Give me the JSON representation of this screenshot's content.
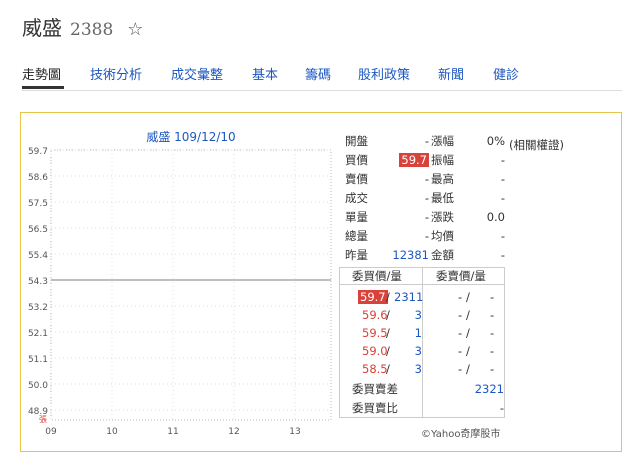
{
  "header": {
    "stock_name": "威盛",
    "stock_code": "2388",
    "favorite_icon": "star-outline-icon"
  },
  "tabs": [
    {
      "label": "走勢圖",
      "active": true
    },
    {
      "label": "技術分析"
    },
    {
      "label": "成交彙整"
    },
    {
      "label": "基本"
    },
    {
      "label": "籌碼"
    },
    {
      "label": "股利政策"
    },
    {
      "label": "新聞"
    },
    {
      "label": "健診"
    }
  ],
  "chart_data": {
    "type": "line",
    "title": "威盛 109/12/10",
    "y_ticks": [
      "59.7",
      "58.6",
      "57.5",
      "56.5",
      "55.4",
      "54.3",
      "53.2",
      "52.1",
      "51.1",
      "50.0",
      "48.9"
    ],
    "y_range": [
      48.9,
      59.7
    ],
    "x_ticks": [
      "09",
      "10",
      "11",
      "12",
      "13"
    ],
    "reference_price": 54.3,
    "bottom_left_label": "張",
    "grid": "dotted"
  },
  "quote": {
    "left": [
      {
        "label": "開盤",
        "value": "-"
      },
      {
        "label": "買價",
        "value": "59.7",
        "highlight": true
      },
      {
        "label": "賣價",
        "value": "-"
      },
      {
        "label": "成交",
        "value": "-"
      },
      {
        "label": "單量",
        "value": "-"
      },
      {
        "label": "總量",
        "value": "-"
      },
      {
        "label": "昨量",
        "value": "12381"
      }
    ],
    "right": [
      {
        "label": "漲幅",
        "value": "0%"
      },
      {
        "label": "振幅",
        "value": "-"
      },
      {
        "label": "最高",
        "value": "-"
      },
      {
        "label": "最低",
        "value": "-"
      },
      {
        "label": "漲跌",
        "value": "0.0"
      },
      {
        "label": "均價",
        "value": "-"
      },
      {
        "label": "金額",
        "value": "-"
      }
    ],
    "related_link": "(相關權證)"
  },
  "order_book": {
    "bid_header": "委買價/量",
    "ask_header": "委賣價/量",
    "bids": [
      {
        "price": "59.7",
        "vol": "2311"
      },
      {
        "price": "59.6",
        "vol": "3"
      },
      {
        "price": "59.5",
        "vol": "1"
      },
      {
        "price": "59.0",
        "vol": "3"
      },
      {
        "price": "58.5",
        "vol": "3"
      }
    ],
    "asks": [
      {
        "price": "-",
        "vol": "-"
      },
      {
        "price": "-",
        "vol": "-"
      },
      {
        "price": "-",
        "vol": "-"
      },
      {
        "price": "-",
        "vol": "-"
      },
      {
        "price": "-",
        "vol": "-"
      }
    ],
    "bid_ask_diff_label": "委買賣差",
    "bid_ask_diff_value": "2321",
    "bid_ask_ratio_label": "委買賣比",
    "bid_ask_ratio_value": "-"
  },
  "credit": "©Yahoo奇摩股市"
}
